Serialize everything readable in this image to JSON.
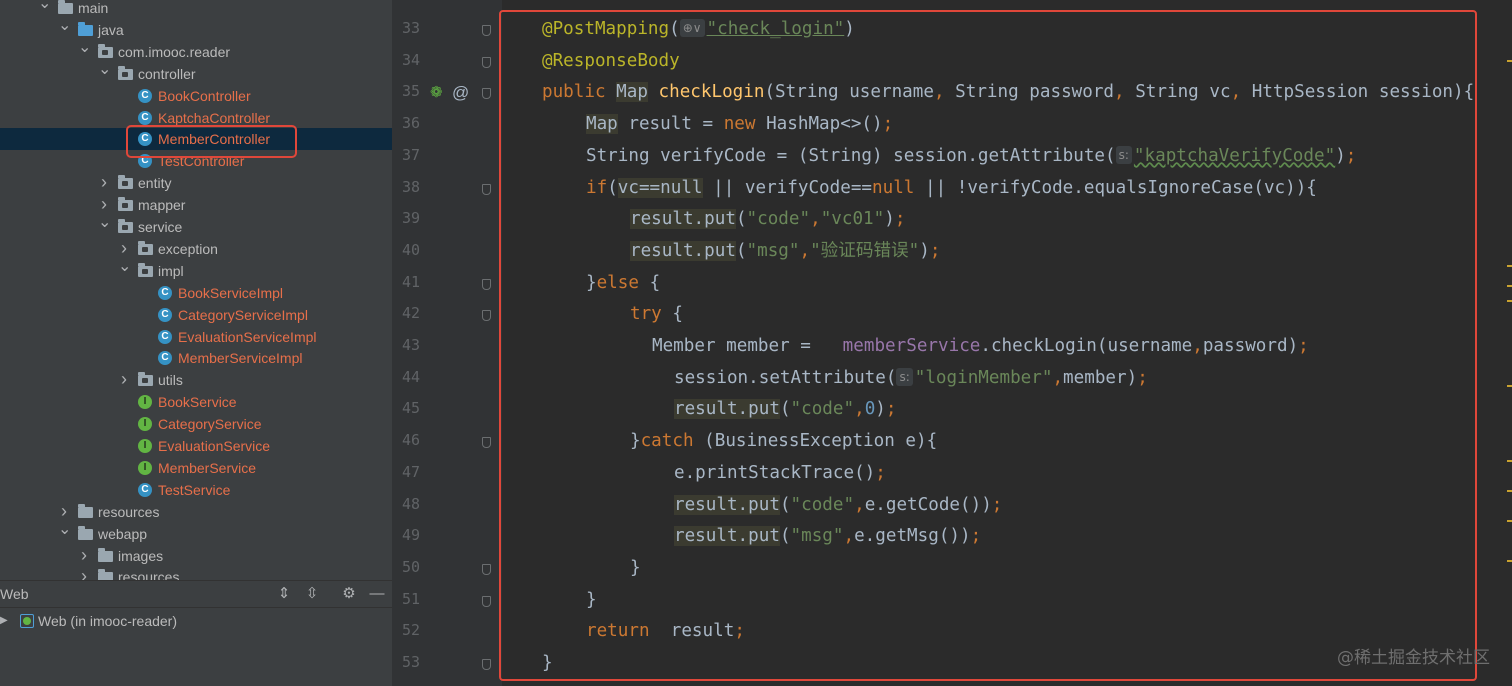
{
  "project_tree": [
    {
      "label": "main",
      "indent": 0,
      "arrow": "expanded",
      "icon": "folder-icon",
      "style": "plain"
    },
    {
      "label": "java",
      "indent": 1,
      "arrow": "expanded",
      "icon": "source-folder-icon",
      "style": "plain"
    },
    {
      "label": "com.imooc.reader",
      "indent": 2,
      "arrow": "expanded",
      "icon": "package-icon",
      "style": "plain"
    },
    {
      "label": "controller",
      "indent": 3,
      "arrow": "expanded",
      "icon": "package-icon",
      "style": "plain"
    },
    {
      "label": "BookController",
      "indent": 4,
      "arrow": "none",
      "icon": "class-icon",
      "style": "class"
    },
    {
      "label": "KaptchaController",
      "indent": 4,
      "arrow": "none",
      "icon": "class-icon",
      "style": "class"
    },
    {
      "label": "MemberController",
      "indent": 4,
      "arrow": "none",
      "icon": "class-icon",
      "style": "class",
      "selected": true
    },
    {
      "label": "TestController",
      "indent": 4,
      "arrow": "none",
      "icon": "class-icon",
      "style": "class"
    },
    {
      "label": "entity",
      "indent": 3,
      "arrow": "collapsed",
      "icon": "package-icon",
      "style": "plain"
    },
    {
      "label": "mapper",
      "indent": 3,
      "arrow": "collapsed",
      "icon": "package-icon",
      "style": "plain"
    },
    {
      "label": "service",
      "indent": 3,
      "arrow": "expanded",
      "icon": "package-icon",
      "style": "plain"
    },
    {
      "label": "exception",
      "indent": 4,
      "arrow": "collapsed",
      "icon": "package-icon",
      "style": "plain"
    },
    {
      "label": "impl",
      "indent": 4,
      "arrow": "expanded",
      "icon": "package-icon",
      "style": "plain"
    },
    {
      "label": "BookServiceImpl",
      "indent": 5,
      "arrow": "none",
      "icon": "class-icon",
      "style": "class"
    },
    {
      "label": "CategoryServiceImpl",
      "indent": 5,
      "arrow": "none",
      "icon": "class-icon",
      "style": "class"
    },
    {
      "label": "EvaluationServiceImpl",
      "indent": 5,
      "arrow": "none",
      "icon": "class-icon",
      "style": "class"
    },
    {
      "label": "MemberServiceImpl",
      "indent": 5,
      "arrow": "none",
      "icon": "class-icon",
      "style": "class"
    },
    {
      "label": "utils",
      "indent": 4,
      "arrow": "collapsed",
      "icon": "package-icon",
      "style": "plain"
    },
    {
      "label": "BookService",
      "indent": 4,
      "arrow": "none",
      "icon": "interface-icon",
      "style": "class"
    },
    {
      "label": "CategoryService",
      "indent": 4,
      "arrow": "none",
      "icon": "interface-icon",
      "style": "class"
    },
    {
      "label": "EvaluationService",
      "indent": 4,
      "arrow": "none",
      "icon": "interface-icon",
      "style": "class"
    },
    {
      "label": "MemberService",
      "indent": 4,
      "arrow": "none",
      "icon": "interface-icon",
      "style": "class"
    },
    {
      "label": "TestService",
      "indent": 4,
      "arrow": "none",
      "icon": "class-icon",
      "style": "class"
    },
    {
      "label": "resources",
      "indent": 1,
      "arrow": "collapsed",
      "icon": "resources-folder-icon",
      "style": "plain"
    },
    {
      "label": "webapp",
      "indent": 1,
      "arrow": "expanded",
      "icon": "web-folder-icon",
      "style": "plain"
    },
    {
      "label": "images",
      "indent": 2,
      "arrow": "collapsed",
      "icon": "folder-icon",
      "style": "plain"
    },
    {
      "label": "resources",
      "indent": 2,
      "arrow": "collapsed",
      "icon": "folder-icon",
      "style": "plain"
    }
  ],
  "services_panel": {
    "title": "Web",
    "buttons": [
      "expand-all-icon",
      "collapse-all-icon",
      "gear-icon",
      "minimize-icon"
    ],
    "item": "Web (in imooc-reader)"
  },
  "editor": {
    "lines": [
      {
        "num": "33",
        "fold": true,
        "tokens": [
          [
            "an",
            "@PostMapping"
          ],
          [
            "p",
            "("
          ],
          [
            "hint",
            "⊕∨"
          ],
          [
            "str-ul",
            "\"check_login\""
          ],
          [
            "p",
            ")"
          ]
        ],
        "indent": 0
      },
      {
        "num": "34",
        "fold": true,
        "tokens": [
          [
            "an",
            "@ResponseBody"
          ]
        ],
        "indent": 0
      },
      {
        "num": "35",
        "fold": true,
        "tokens": [
          [
            "kw",
            "public "
          ],
          [
            "hl",
            "Map"
          ],
          [
            "p",
            " "
          ],
          [
            "fn",
            "checkLogin"
          ],
          [
            "p",
            "(String username"
          ],
          [
            "kw",
            ", "
          ],
          [
            "p",
            "String password"
          ],
          [
            "kw",
            ", "
          ],
          [
            "p",
            "String vc"
          ],
          [
            "kw",
            ", "
          ],
          [
            "p",
            "HttpSession session){"
          ]
        ],
        "indent": 0
      },
      {
        "num": "36",
        "fold": false,
        "tokens": [
          [
            "hl",
            "Map"
          ],
          [
            "p",
            " result = "
          ],
          [
            "kw",
            "new "
          ],
          [
            "p",
            "HashMap<>()"
          ],
          [
            "kw",
            ";"
          ]
        ],
        "indent": 1
      },
      {
        "num": "37",
        "fold": false,
        "tokens": [
          [
            "p",
            "String verifyCode = (String) session.getAttribute("
          ],
          [
            "hint",
            "s:"
          ],
          [
            "str-wavy",
            "\"kaptchaVerifyCode\""
          ],
          [
            "p",
            ")"
          ],
          [
            "kw",
            ";"
          ]
        ],
        "indent": 1
      },
      {
        "num": "38",
        "fold": true,
        "tokens": [
          [
            "kw",
            "if"
          ],
          [
            "p",
            "("
          ],
          [
            "hl",
            "vc==null"
          ],
          [
            "p",
            " || verifyCode=="
          ],
          [
            "kw",
            "null"
          ],
          [
            "p",
            " || !verifyCode.equalsIgnoreCase(vc)){"
          ]
        ],
        "indent": 1
      },
      {
        "num": "39",
        "fold": false,
        "tokens": [
          [
            "hl",
            "result.put"
          ],
          [
            "p",
            "("
          ],
          [
            "str",
            "\"code\""
          ],
          [
            "kw",
            ","
          ],
          [
            "str",
            "\"vc01\""
          ],
          [
            "p",
            ")"
          ],
          [
            "kw",
            ";"
          ]
        ],
        "indent": 2
      },
      {
        "num": "40",
        "fold": false,
        "tokens": [
          [
            "hl",
            "result.put"
          ],
          [
            "p",
            "("
          ],
          [
            "str",
            "\"msg\""
          ],
          [
            "kw",
            ","
          ],
          [
            "str",
            "\"验证码错误\""
          ],
          [
            "p",
            ")"
          ],
          [
            "kw",
            ";"
          ]
        ],
        "indent": 2
      },
      {
        "num": "41",
        "fold": true,
        "tokens": [
          [
            "p",
            "}"
          ],
          [
            "kw",
            "else "
          ],
          [
            "p",
            "{"
          ]
        ],
        "indent": 1
      },
      {
        "num": "42",
        "fold": true,
        "tokens": [
          [
            "kw",
            "try "
          ],
          [
            "p",
            "{"
          ]
        ],
        "indent": 2
      },
      {
        "num": "43",
        "fold": false,
        "tokens": [
          [
            "p",
            "Member member =   "
          ],
          [
            "fld",
            "memberService"
          ],
          [
            "p",
            ".checkLogin(username"
          ],
          [
            "kw",
            ","
          ],
          [
            "p",
            "password)"
          ],
          [
            "kw",
            ";"
          ]
        ],
        "indent": 2.5
      },
      {
        "num": "44",
        "fold": false,
        "tokens": [
          [
            "p",
            "session.setAttribute("
          ],
          [
            "hint",
            "s:"
          ],
          [
            "str",
            "\"loginMember\""
          ],
          [
            "kw",
            ","
          ],
          [
            "p",
            "member)"
          ],
          [
            "kw",
            ";"
          ]
        ],
        "indent": 3
      },
      {
        "num": "45",
        "fold": false,
        "tokens": [
          [
            "hl",
            "result.put"
          ],
          [
            "p",
            "("
          ],
          [
            "str",
            "\"code\""
          ],
          [
            "kw",
            ","
          ],
          [
            "num",
            "0"
          ],
          [
            "p",
            ")"
          ],
          [
            "kw",
            ";"
          ]
        ],
        "indent": 3
      },
      {
        "num": "46",
        "fold": true,
        "tokens": [
          [
            "p",
            "}"
          ],
          [
            "kw",
            "catch "
          ],
          [
            "p",
            "(BusinessException e){"
          ]
        ],
        "indent": 2
      },
      {
        "num": "47",
        "fold": false,
        "tokens": [
          [
            "p",
            "e.printStackTrace()"
          ],
          [
            "kw",
            ";"
          ]
        ],
        "indent": 3
      },
      {
        "num": "48",
        "fold": false,
        "tokens": [
          [
            "hl",
            "result.put"
          ],
          [
            "p",
            "("
          ],
          [
            "str",
            "\"code\""
          ],
          [
            "kw",
            ","
          ],
          [
            "p",
            "e.getCode())"
          ],
          [
            "kw",
            ";"
          ]
        ],
        "indent": 3
      },
      {
        "num": "49",
        "fold": false,
        "tokens": [
          [
            "hl",
            "result.put"
          ],
          [
            "p",
            "("
          ],
          [
            "str",
            "\"msg\""
          ],
          [
            "kw",
            ","
          ],
          [
            "p",
            "e.getMsg())"
          ],
          [
            "kw",
            ";"
          ]
        ],
        "indent": 3
      },
      {
        "num": "50",
        "fold": true,
        "tokens": [
          [
            "p",
            "}"
          ]
        ],
        "indent": 2
      },
      {
        "num": "51",
        "fold": true,
        "tokens": [
          [
            "p",
            "}"
          ]
        ],
        "indent": 1
      },
      {
        "num": "52",
        "fold": false,
        "tokens": [
          [
            "kw",
            "return  "
          ],
          [
            "p",
            "result"
          ],
          [
            "kw",
            ";"
          ]
        ],
        "indent": 1
      },
      {
        "num": "53",
        "fold": true,
        "tokens": [
          [
            "p",
            "}"
          ]
        ],
        "indent": 0
      }
    ],
    "gutter_icons": [
      "spring-bean-icon",
      "at-sign-icon"
    ],
    "gutter_symbols": {
      "spring": "❁",
      "at": "@"
    }
  },
  "watermark": "@稀土掘金技术社区",
  "colors": {
    "highlight": "#e0473a",
    "keyword": "#cc7832",
    "annotation": "#bbb529",
    "string": "#6a8759",
    "method": "#ffc66d"
  }
}
